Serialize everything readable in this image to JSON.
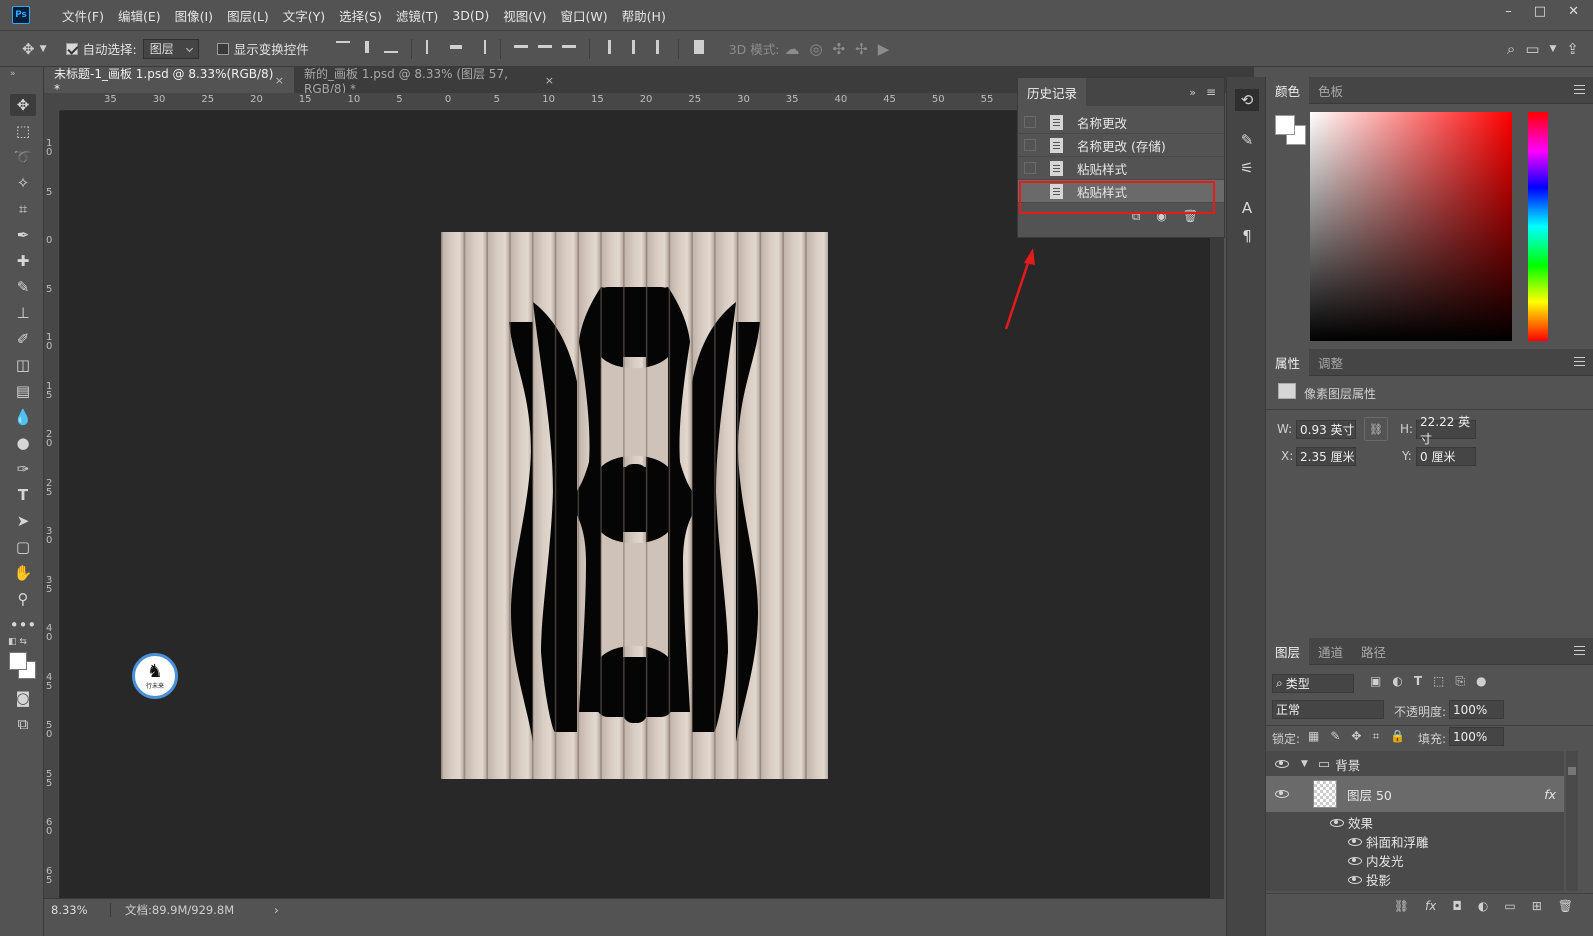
{
  "app": {
    "logo": "Ps"
  },
  "menubar": {
    "items": [
      "文件(F)",
      "编辑(E)",
      "图像(I)",
      "图层(L)",
      "文字(Y)",
      "选择(S)",
      "滤镜(T)",
      "3D(D)",
      "视图(V)",
      "窗口(W)",
      "帮助(H)"
    ],
    "window_controls": [
      "–",
      "□",
      "✕"
    ]
  },
  "options": {
    "auto_select_label": "自动选择:",
    "auto_select_checked": true,
    "layer_select_value": "图层",
    "show_transform_label": "显示变换控件",
    "show_transform_checked": false,
    "mode_3d_label": "3D 模式:"
  },
  "tabs": [
    {
      "label": "未标题-1_画板 1.psd @ 8.33%(RGB/8) *",
      "close": "×"
    },
    {
      "label": "新的_画板 1.psd @ 8.33% (图层 57, RGB/8) *",
      "close": "×"
    }
  ],
  "ruler_top": [
    "35",
    "30",
    "25",
    "20",
    "15",
    "10",
    "5",
    "0",
    "5",
    "10",
    "15",
    "20",
    "25",
    "30",
    "35",
    "40",
    "45",
    "50",
    "55"
  ],
  "ruler_left": [
    "1\n0",
    "5",
    "0",
    "5",
    "1\n0",
    "1\n5",
    "2\n0",
    "2\n5",
    "3\n0",
    "3\n5",
    "4\n0",
    "4\n5",
    "5\n0",
    "5\n5",
    "6\n0",
    "6\n5"
  ],
  "status": {
    "zoom": "8.33%",
    "doc_info": "文档:89.9M/929.8M",
    "expand": "›"
  },
  "history": {
    "tab_label": "历史记录",
    "items": [
      {
        "label": "名称更改",
        "selected": false
      },
      {
        "label": "名称更改 (存储)",
        "selected": false
      },
      {
        "label": "粘贴样式",
        "selected": false
      },
      {
        "label": "粘贴样式",
        "selected": true
      }
    ]
  },
  "color_panel": {
    "tabs": [
      "颜色",
      "色板"
    ],
    "foreground": "#ffffff",
    "background": "#ffffff"
  },
  "properties": {
    "tabs": [
      "属性",
      "调整"
    ],
    "title": "像素图层属性",
    "w_label": "W:",
    "w_value": "0.93 英寸",
    "h_label": "H:",
    "h_value": "22.22 英寸",
    "x_label": "X:",
    "x_value": "2.35 厘米",
    "y_label": "Y:",
    "y_value": "0 厘米"
  },
  "layers_panel": {
    "tabs": [
      "图层",
      "通道",
      "路径"
    ],
    "filter_label": "类型",
    "blend_mode": "正常",
    "opacity_label": "不透明度:",
    "opacity_value": "100%",
    "lock_label": "锁定:",
    "fill_label": "填充:",
    "fill_value": "100%",
    "group_name": "背景",
    "layer_name": "图层 50",
    "fx": "fx",
    "effects_label": "效果",
    "effects": [
      "斜面和浮雕",
      "内发光",
      "投影"
    ]
  },
  "watermark": {
    "text": "行未来"
  }
}
